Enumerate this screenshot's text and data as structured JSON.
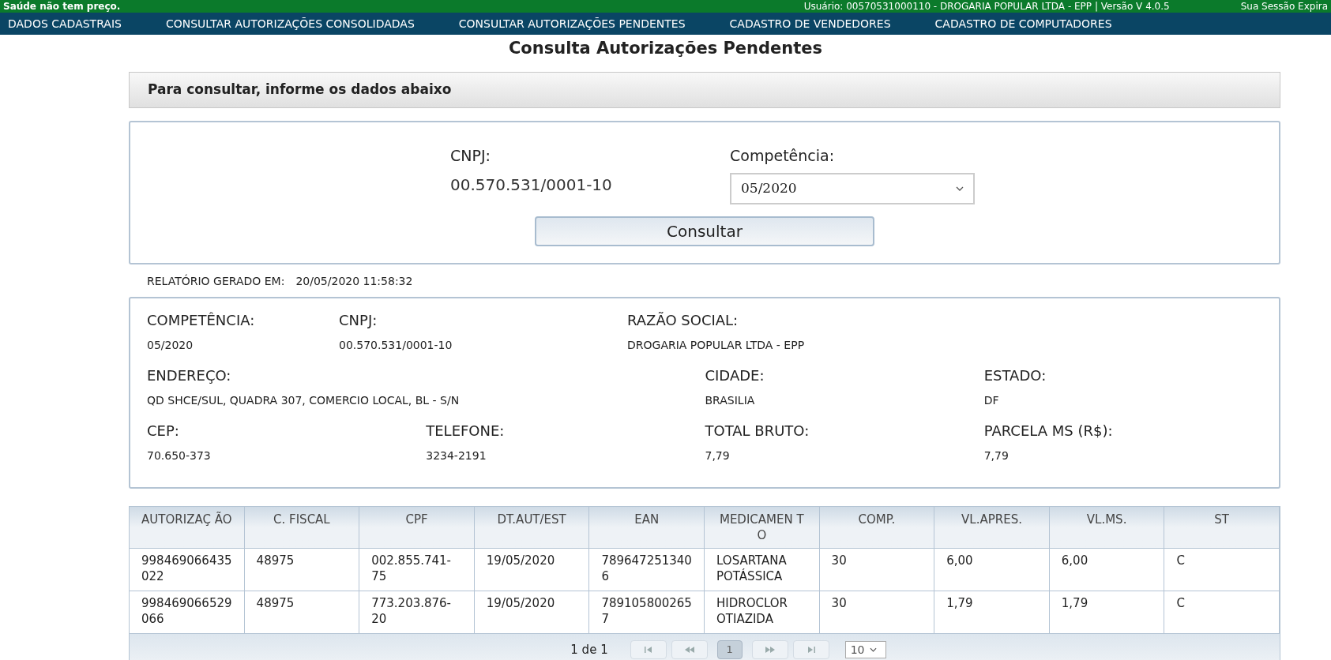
{
  "top_bar": {
    "slogan": "Saúde não tem preço.",
    "user_info": "Usuário: 00570531000110 - DROGARIA POPULAR LTDA - EPP | Versão V 4.0.5",
    "session": "Sua Sessão Expira"
  },
  "menu": [
    {
      "label": "DADOS CADASTRAIS"
    },
    {
      "label": "CONSULTAR AUTORIZAÇÕES CONSOLIDADAS"
    },
    {
      "label": "CONSULTAR AUTORIZAÇÕES PENDENTES"
    },
    {
      "label": "CADASTRO DE VENDEDORES"
    },
    {
      "label": "CADASTRO DE COMPUTADORES"
    }
  ],
  "page_title": "Consulta Autorizações Pendentes",
  "panel_header": "Para consultar, informe os dados abaixo",
  "form": {
    "cnpj_label": "CNPJ:",
    "cnpj_value": "00.570.531/0001-10",
    "competencia_label": "Competência:",
    "competencia_value": "05/2020",
    "button": "Consultar"
  },
  "report": {
    "label": "RELATÓRIO GERADO EM:",
    "value": "20/05/2020 11:58:32"
  },
  "info_rows": [
    [
      {
        "label": "COMPETÊNCIA:",
        "value": "05/2020"
      },
      {
        "label": "CNPJ:",
        "value": "00.570.531/0001-10"
      },
      {
        "label": "RAZÃO SOCIAL:",
        "value": "DROGARIA POPULAR LTDA - EPP"
      }
    ],
    [
      {
        "label": "ENDEREÇO:",
        "value": "QD SHCE/SUL, QUADRA 307, COMERCIO LOCAL, BL - S/N"
      },
      {
        "label": "CIDADE:",
        "value": "BRASILIA"
      },
      {
        "label": "ESTADO:",
        "value": "DF"
      }
    ],
    [
      {
        "label": "CEP:",
        "value": "70.650-373"
      },
      {
        "label": "TELEFONE:",
        "value": "3234-2191"
      },
      {
        "label": "TOTAL BRUTO:",
        "value": "7,79"
      },
      {
        "label": "PARCELA MS (R$):",
        "value": "7,79"
      }
    ]
  ],
  "table": {
    "columns": [
      "AUTORIZAÇ ÃO",
      "C. FISCAL",
      "CPF",
      "DT.AUT/EST",
      "EAN",
      "MEDICAMEN TO",
      "COMP.",
      "VL.APRES.",
      "VL.MS.",
      "ST"
    ],
    "rows": [
      [
        "998469066435022",
        "48975",
        "002.855.741-75",
        "19/05/2020",
        "7896472513406",
        "LOSARTANA POTÁSSICA",
        "30",
        "6,00",
        "6,00",
        "C"
      ],
      [
        "998469066529066",
        "48975",
        "773.203.876-20",
        "19/05/2020",
        "7891058002657",
        "HIDROCLOR OTIAZIDA",
        "30",
        "1,79",
        "1,79",
        "C"
      ]
    ]
  },
  "pager": {
    "info": "1 de 1",
    "pages": [
      {
        "label": "1",
        "selected": true
      }
    ],
    "page_size": "10"
  }
}
